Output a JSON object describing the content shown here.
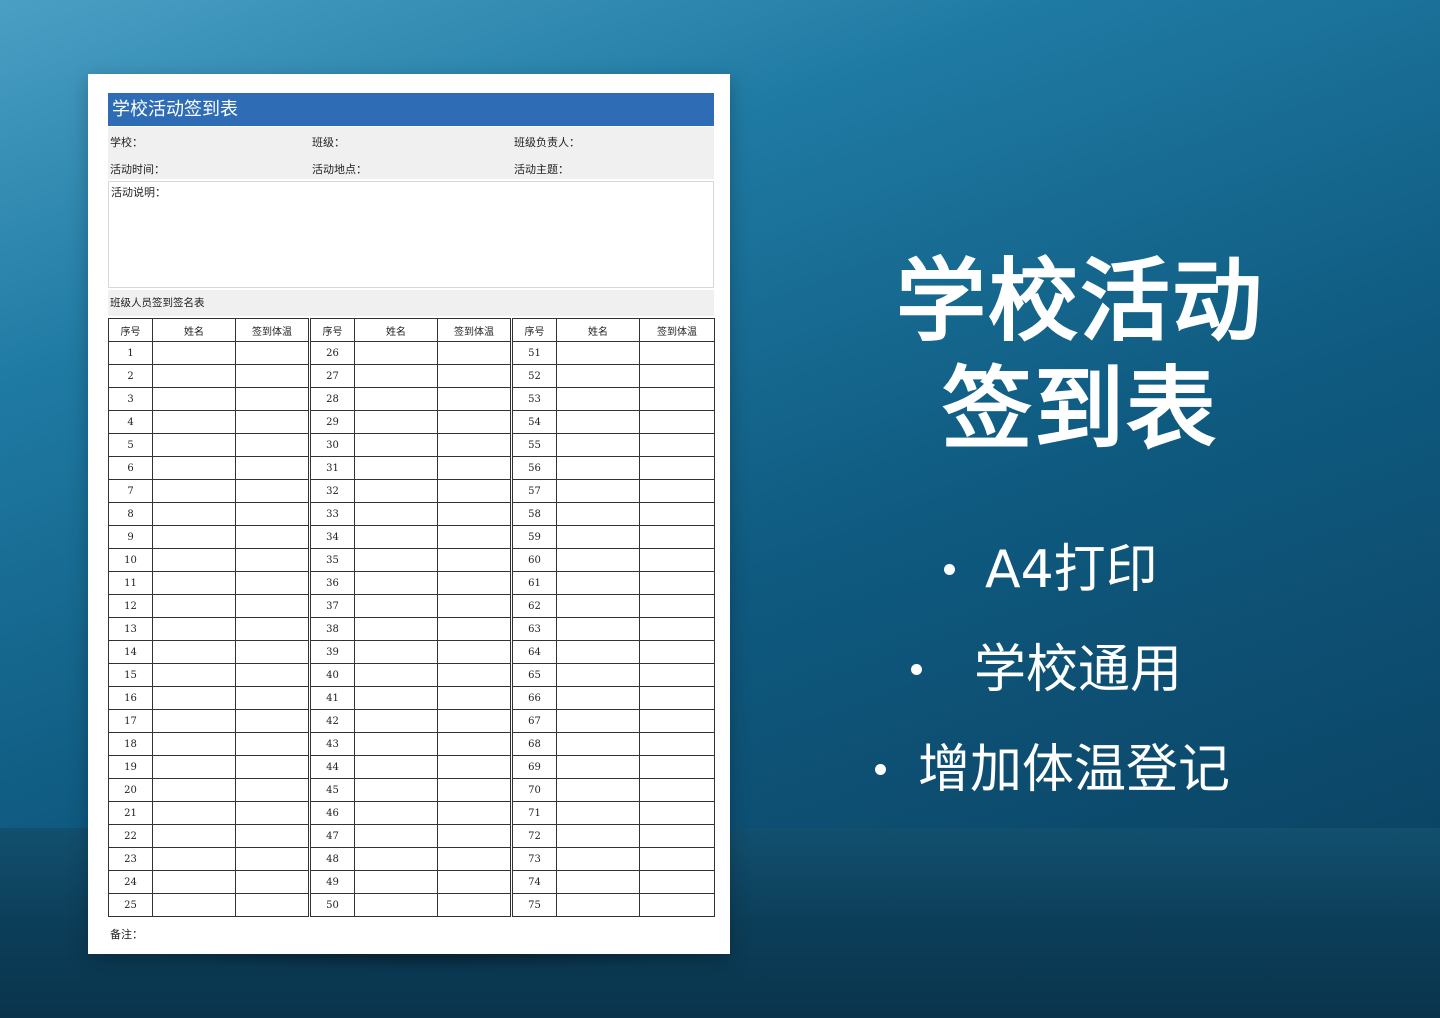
{
  "document": {
    "title": "学校活动签到表",
    "fields": {
      "school": "学校：",
      "class": "班级：",
      "class_leader": "班级负责人：",
      "activity_time": "活动时间：",
      "activity_location": "活动地点：",
      "activity_theme": "活动主题：",
      "description": "活动说明："
    },
    "roster_title": "班级人员签到签名表",
    "columns": [
      "序号",
      "姓名",
      "签到体温"
    ],
    "numbers": [
      [
        "1",
        "2",
        "3",
        "4",
        "5",
        "6",
        "7",
        "8",
        "9",
        "10",
        "11",
        "12",
        "13",
        "14",
        "15",
        "16",
        "17",
        "18",
        "19",
        "20",
        "21",
        "22",
        "23",
        "24",
        "25"
      ],
      [
        "26",
        "27",
        "28",
        "29",
        "30",
        "31",
        "32",
        "33",
        "34",
        "35",
        "36",
        "37",
        "38",
        "39",
        "40",
        "41",
        "42",
        "43",
        "44",
        "45",
        "46",
        "47",
        "48",
        "49",
        "50"
      ],
      [
        "51",
        "52",
        "53",
        "54",
        "55",
        "56",
        "57",
        "58",
        "59",
        "60",
        "61",
        "62",
        "63",
        "64",
        "65",
        "66",
        "67",
        "68",
        "69",
        "70",
        "71",
        "72",
        "73",
        "74",
        "75"
      ]
    ],
    "remarks": "备注："
  },
  "promo": {
    "headline_line1": "学校活动",
    "headline_line2": "签到表",
    "features": [
      "A4打印",
      "学校通用",
      "增加体温登记"
    ]
  },
  "colors": {
    "title_bar": "#2e6db5",
    "background": "#0f5a80"
  }
}
